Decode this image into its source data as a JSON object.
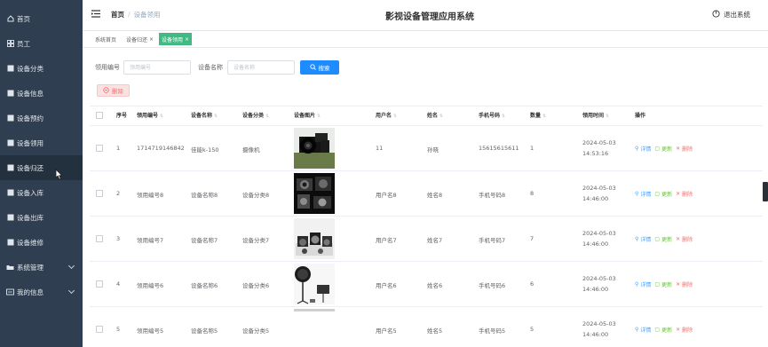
{
  "sidebar": {
    "items": [
      {
        "label": "首页",
        "icon": "home-icon"
      },
      {
        "label": "员工",
        "icon": "grid-icon"
      },
      {
        "label": "设备分类",
        "icon": "grid-icon"
      },
      {
        "label": "设备信息",
        "icon": "grid-icon"
      },
      {
        "label": "设备预约",
        "icon": "grid-icon"
      },
      {
        "label": "设备领用",
        "icon": "grid-icon"
      },
      {
        "label": "设备归还",
        "icon": "grid-icon"
      },
      {
        "label": "设备入库",
        "icon": "grid-icon"
      },
      {
        "label": "设备出库",
        "icon": "grid-icon"
      },
      {
        "label": "设备维修",
        "icon": "grid-icon"
      },
      {
        "label": "系统管理",
        "icon": "folder-icon"
      },
      {
        "label": "我的信息",
        "icon": "card-icon"
      }
    ]
  },
  "header": {
    "breadcrumb_home": "首页",
    "breadcrumb_sep": "/",
    "breadcrumb_current": "设备领用",
    "app_title": "影视设备管理应用系统",
    "logout_label": "退出系统"
  },
  "tabs": [
    {
      "label": "系统首页",
      "closable": false,
      "active": false
    },
    {
      "label": "设备归还",
      "closable": true,
      "active": false
    },
    {
      "label": "设备领用",
      "closable": true,
      "active": true
    }
  ],
  "search": {
    "field1_label": "领用编号",
    "field1_placeholder": "领用编号",
    "field2_label": "设备名称",
    "field2_placeholder": "设备名称",
    "button_label": "搜索"
  },
  "toolbar": {
    "delete_label": "删除"
  },
  "table": {
    "columns": [
      "序号",
      "领用编号",
      "设备名称",
      "设备分类",
      "设备图片",
      "用户名",
      "姓名",
      "手机号码",
      "数量",
      "领用时间",
      "操作"
    ],
    "rows": [
      {
        "idx": "1",
        "code": "1714719146842",
        "name": "佳能k-150",
        "cat": "摄像机",
        "user": "11",
        "real": "孙晓",
        "phone": "15615615611",
        "qty": "1",
        "time": "2024-05-03 14:53:16"
      },
      {
        "idx": "2",
        "code": "领用编号8",
        "name": "设备名称8",
        "cat": "设备分类8",
        "user": "用户名8",
        "real": "姓名8",
        "phone": "手机号码8",
        "qty": "8",
        "time": "2024-05-03 14:46:00"
      },
      {
        "idx": "3",
        "code": "领用编号7",
        "name": "设备名称7",
        "cat": "设备分类7",
        "user": "用户名7",
        "real": "姓名7",
        "phone": "手机号码7",
        "qty": "7",
        "time": "2024-05-03 14:46:00"
      },
      {
        "idx": "4",
        "code": "领用编号6",
        "name": "设备名称6",
        "cat": "设备分类6",
        "user": "用户名6",
        "real": "姓名6",
        "phone": "手机号码6",
        "qty": "6",
        "time": "2024-05-03 14:46:00"
      },
      {
        "idx": "5",
        "code": "领用编号5",
        "name": "设备名称5",
        "cat": "设备分类5",
        "user": "用户名5",
        "real": "姓名5",
        "phone": "手机号码5",
        "qty": "5",
        "time": "2024-05-03 14:46:00"
      }
    ],
    "ops": {
      "detail": "详情",
      "edit": "更新",
      "delete": "删除"
    }
  },
  "colors": {
    "sidebar_bg": "#2f3e50",
    "active_tab": "#42b983",
    "primary": "#1e8bff",
    "danger": "#f56c6c",
    "success": "#67c23a"
  }
}
